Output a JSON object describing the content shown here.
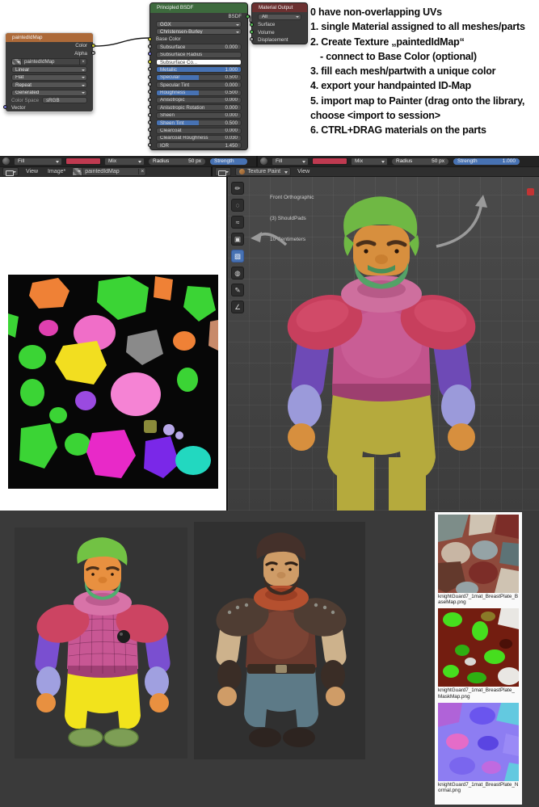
{
  "instructions": {
    "lines": [
      "0 have non-overlapping UVs",
      "1. single Material assigned to all meshes/parts",
      "2. Create Texture „paintedIdMap“",
      "- connect to Base Color (optional)",
      "3. fill each mesh/partwith a unique color",
      "4. export your handpainted ID-Map",
      "5. import map to Painter (drag onto the library,",
      "choose <import to session>",
      "6. CTRL+DRAG materials on the parts"
    ]
  },
  "nodes": {
    "image_node": {
      "title": "paintedIdMap",
      "out_color": "Color",
      "out_alpha": "Alpha",
      "datablock": "paintedIdMap",
      "interpolation": "Linear",
      "projection": "Flat",
      "extension": "Repeat",
      "source": "Generated",
      "color_space_label": "Color Space",
      "color_space_value": "sRGB",
      "input_vector": "Vector"
    },
    "principled": {
      "title": "Principled BSDF",
      "out_bsdf": "BSDF",
      "distribution": "GGX",
      "subsurface_method": "Christensen-Burley",
      "base_color": "Base Color",
      "rows": [
        {
          "label": "Subsurface",
          "value": "0.000"
        },
        {
          "label": "Subsurface Radius",
          "value": ""
        },
        {
          "label": "Subsurface Co...",
          "value": ""
        },
        {
          "label": "Metallic",
          "value": "1.000"
        },
        {
          "label": "Specular",
          "value": "0.500"
        },
        {
          "label": "Specular Tint",
          "value": "0.000"
        },
        {
          "label": "Roughness",
          "value": "0.500"
        },
        {
          "label": "Anisotropic",
          "value": "0.000"
        },
        {
          "label": "Anisotropic Rotation",
          "value": "0.000"
        },
        {
          "label": "Sheen",
          "value": "0.000"
        },
        {
          "label": "Sheen Tint",
          "value": "0.500"
        },
        {
          "label": "Clearcoat",
          "value": "0.000"
        },
        {
          "label": "Clearcoat Roughness",
          "value": "0.030"
        },
        {
          "label": "IOR",
          "value": "1.450"
        }
      ]
    },
    "material_output": {
      "title": "Material Output",
      "target": "All",
      "in_surface": "Surface",
      "in_volume": "Volume",
      "in_displacement": "Displacement"
    }
  },
  "paint_header_left": {
    "brush": "Fill",
    "blend": "Mix",
    "radius_label": "Radius",
    "radius_value": "50 px",
    "strength_label": "Strength"
  },
  "paint_header_right": {
    "brush": "Fill",
    "blend": "Mix",
    "radius_label": "Radius",
    "radius_value": "50 px",
    "strength_label": "Strength",
    "strength_value": "1.000"
  },
  "image_editor_menu": {
    "view": "View",
    "image": "Image*",
    "datablock": "paintedIdMap"
  },
  "viewport_menu": {
    "mode": "Texture Paint",
    "view": "View"
  },
  "viewport": {
    "orientation": "Front Orthographic",
    "selection": "(3) ShouldPads",
    "scale": "10 Centimeters"
  },
  "texture_files": [
    {
      "filename": "knightGuard7_1mat_BreastPlate_BaseMap.png"
    },
    {
      "filename": "knightGuard7_1mat_BreastPlate_MaskMap.png"
    },
    {
      "filename": "knightGuard7_1mat_BreastPlate_Normal.png"
    }
  ],
  "palette": {
    "accent_blue": "#4772b3",
    "brush_red": "#bf3a50",
    "node_image_header": "#ad6a39",
    "node_shader_header": "#3d6a3d",
    "node_output_header": "#6b3030",
    "viewport_bg": "#434343",
    "bottom_bg": "#3a3a3a"
  }
}
